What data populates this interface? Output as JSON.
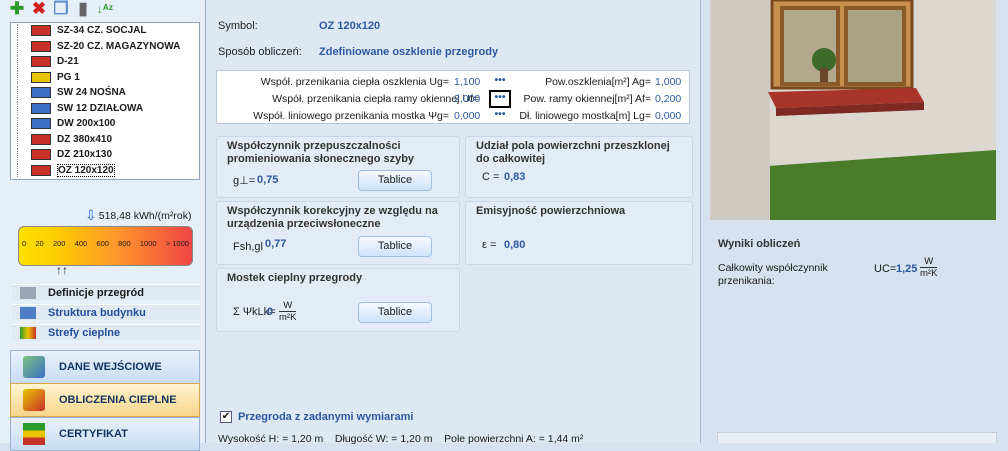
{
  "toolbar": {
    "icons": [
      "add-icon",
      "delete-icon",
      "copy-icon",
      "paste-icon",
      "sort-az-icon"
    ]
  },
  "tree": [
    {
      "label": "SZ-34 CZ. SOCJAL",
      "icon": "wall-red-icon",
      "color": "#c8302a"
    },
    {
      "label": "SZ-20 CZ. MAGAZYNOWA",
      "icon": "wall-red-icon",
      "color": "#c8302a"
    },
    {
      "label": "D-21",
      "icon": "roof-icon",
      "color": "#c8302a"
    },
    {
      "label": "PG 1",
      "icon": "floor-icon",
      "color": "#e8c400"
    },
    {
      "label": "SW 24 NOŚNA",
      "icon": "wall-blue-icon",
      "color": "#3a6fc4"
    },
    {
      "label": "SW 12 DZIAŁOWA",
      "icon": "wall-blue-icon",
      "color": "#3a6fc4"
    },
    {
      "label": "DW 200x100",
      "icon": "door-icon",
      "color": "#3a6fc4"
    },
    {
      "label": "DZ 380x410",
      "icon": "window-icon",
      "color": "#c8302a"
    },
    {
      "label": "DZ 210x130",
      "icon": "window-icon",
      "color": "#c8302a"
    },
    {
      "label": "OZ 120x120",
      "icon": "window-icon",
      "color": "#c8302a"
    }
  ],
  "scale": {
    "value": "518,48 kWh/(m²rok)",
    "ticks": [
      "0",
      "20",
      "200",
      "400",
      "600",
      "800",
      "1000",
      "> 1000"
    ]
  },
  "nav_small": [
    "Definicje przegród",
    "Struktura budynku",
    "Strefy cieplne"
  ],
  "nav_big": [
    "DANE WEJŚCIOWE",
    "OBLICZENIA CIEPLNE",
    "CERTYFIKAT"
  ],
  "main": {
    "symbol_label": "Symbol:",
    "symbol_value": "OZ 120x120",
    "method_label": "Sposób obliczeń:",
    "method_value": "Zdefiniowane oszklenie przegrody",
    "params": [
      {
        "label": "Współ. przenikania ciepła oszklenia Ug=",
        "value": "1,100",
        "rlabel": "Pow.oszklenia[m²] Ag=",
        "rvalue": "1,000"
      },
      {
        "label": "Współ. przenikania ciepła ramy okiennej Uf=",
        "value": "2,000",
        "rlabel": "Pow. ramy okiennej[m²] Af=",
        "rvalue": "0,200"
      },
      {
        "label": "Współ. liniowego przenikania mostka Ψg=",
        "value": "0,000",
        "rlabel": "Dł. liniowego mostka[m] Lg=",
        "rvalue": "0,000"
      }
    ],
    "dots": "•••",
    "p1": {
      "title": "Współczynnik przepuszczalności promieniowania słonecznego szyby",
      "sym": "g⊥=",
      "val": "0,75",
      "btn": "Tablice"
    },
    "p2": {
      "title": "Udział pola powierzchni przeszklonej do całkowitej",
      "sym": "C =",
      "val": "0,83"
    },
    "p3": {
      "title": "Współczynnik korekcyjny ze względu na urządzenia przeciwsłoneczne",
      "sym": "Fsh,gl",
      "val": "0,77",
      "btn": "Tablice"
    },
    "p4": {
      "title": "Emisyjność powierzchniowa",
      "sym": "ε =",
      "val": "0,80"
    },
    "p5": {
      "title": "Mostek cieplny przegrody",
      "sym": "Σ ΨkLk=",
      "val": "0",
      "unit_num": "W",
      "unit_den": "m²K",
      "btn": "Tablice"
    },
    "dims": {
      "check_label": "Przegroda z zadanymi wymiarami",
      "line": "Wysokość H: = 1,20 m    Długość W: = 1,20 m    Pole powierzchni A: = 1,44 m²"
    }
  },
  "results": {
    "title": "Wyniki obliczeń",
    "label": "Całkowity współczynnik przenikania:",
    "sym": "UC=",
    "val": "1,25",
    "unit_num": "W",
    "unit_den": "m²K"
  }
}
